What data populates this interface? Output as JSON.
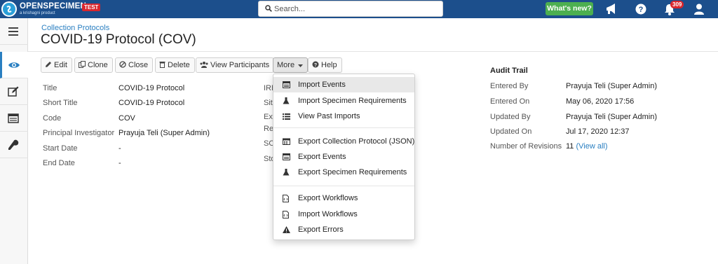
{
  "navbar": {
    "logo_text": "OPENSPECIMEN",
    "logo_subtext": "a krishagni product",
    "env_badge": "TEST",
    "search_placeholder": "Search...",
    "whats_new_label": "What's new?",
    "notification_count": "309"
  },
  "colors": {
    "navbar_bg": "#1c4f8c",
    "accent": "#2a7fc1",
    "whats_new_bg": "#4caf50",
    "badge_red": "#d9272e"
  },
  "sidebar": {
    "items": [
      {
        "icon": "menu-icon"
      },
      {
        "icon": "eye-icon",
        "active": true
      },
      {
        "icon": "edit-icon"
      },
      {
        "icon": "list-icon"
      },
      {
        "icon": "wrench-icon"
      }
    ]
  },
  "header": {
    "breadcrumb": "Collection Protocols",
    "title": "COVID-19 Protocol (COV)"
  },
  "toolbar": {
    "edit": "Edit",
    "clone": "Clone",
    "close": "Close",
    "delete": "Delete",
    "view_participants": "View Participants",
    "more": "More",
    "help": "Help"
  },
  "details": {
    "rows": [
      {
        "label": "Title",
        "value": "COVID-19 Protocol"
      },
      {
        "label": "Short Title",
        "value": "COVID-19 Protocol"
      },
      {
        "label": "Code",
        "value": "COV"
      },
      {
        "label": "Principal Investigator",
        "value": "Prayuja Teli (Super Admin)"
      },
      {
        "label": "Start Date",
        "value": "-"
      },
      {
        "label": "End Date",
        "value": "-"
      }
    ],
    "middle_labels": [
      "IRB",
      "Site",
      "Exp",
      "Re",
      "SO",
      "Sto"
    ]
  },
  "audit": {
    "title": "Audit Trail",
    "rows": [
      {
        "label": "Entered By",
        "value": "Prayuja Teli (Super Admin)"
      },
      {
        "label": "Entered On",
        "value": "May 06, 2020 17:56"
      },
      {
        "label": "Updated By",
        "value": "Prayuja Teli (Super Admin)"
      },
      {
        "label": "Updated On",
        "value": "Jul 17, 2020 12:37"
      },
      {
        "label": "Number of Revisions",
        "value": "11",
        "link": "(View all)"
      }
    ]
  },
  "more_menu": {
    "group1": [
      {
        "label": "Import Events",
        "icon": "table-icon"
      },
      {
        "label": "Import Specimen Requirements",
        "icon": "flask-icon"
      },
      {
        "label": "View Past Imports",
        "icon": "list-icon"
      }
    ],
    "group2": [
      {
        "label": "Export Collection Protocol (JSON)",
        "icon": "calendar-icon"
      },
      {
        "label": "Export Events",
        "icon": "table-icon"
      },
      {
        "label": "Export Specimen Requirements",
        "icon": "flask-icon"
      }
    ],
    "group3": [
      {
        "label": "Export Workflows",
        "icon": "file-code-icon"
      },
      {
        "label": "Import Workflows",
        "icon": "file-code-icon"
      },
      {
        "label": "Export Errors",
        "icon": "warning-icon"
      }
    ]
  }
}
